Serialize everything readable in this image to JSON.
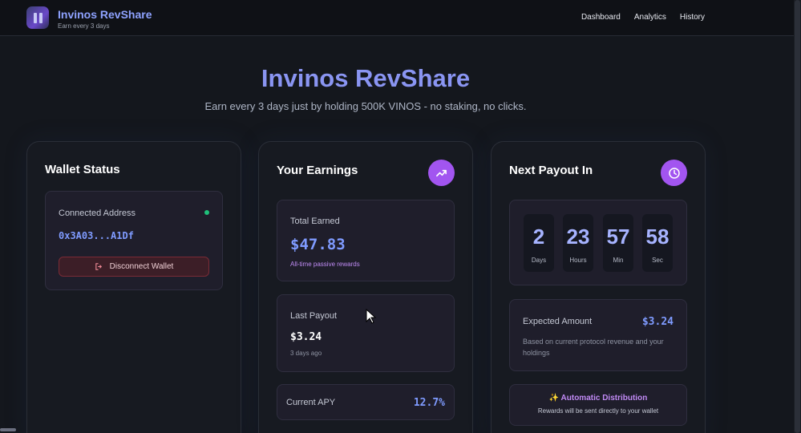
{
  "nav": {
    "brand_title": "Invinos RevShare",
    "brand_subtitle": "Earn every 3 days",
    "links": [
      "Dashboard",
      "Analytics",
      "History"
    ]
  },
  "hero": {
    "title": "Invinos RevShare",
    "subtitle": "Earn every 3 days just by holding 500K VINOS - no staking, no clicks."
  },
  "wallet": {
    "title": "Wallet Status",
    "connected_label": "Connected Address",
    "address": "0x3A03...A1Df",
    "disconnect_label": "Disconnect Wallet",
    "status_color": "#1fc07a"
  },
  "earnings": {
    "title": "Your Earnings",
    "badge_icon": "trending-up-icon",
    "total_label": "Total Earned",
    "total_value": "$47.83",
    "total_note": "All-time passive rewards",
    "last_label": "Last Payout",
    "last_value": "$3.24",
    "last_note": "3 days ago",
    "apy_label": "Current APY",
    "apy_value": "12.7%"
  },
  "payout": {
    "title": "Next Payout In",
    "badge_icon": "clock-icon",
    "countdown": [
      {
        "value": "2",
        "unit": "Days"
      },
      {
        "value": "23",
        "unit": "Hours"
      },
      {
        "value": "57",
        "unit": "Min"
      },
      {
        "value": "58",
        "unit": "Sec"
      }
    ],
    "expected_label": "Expected Amount",
    "expected_value": "$3.24",
    "expected_note": "Based on current protocol revenue and your holdings",
    "auto_title": "✨ Automatic Distribution",
    "auto_note": "Rewards will be sent directly to your wallet"
  },
  "colors": {
    "accent": "#8a95f2",
    "badge": "#a255f0",
    "value_blue": "#7f9bff",
    "danger": "#7a2b36"
  }
}
